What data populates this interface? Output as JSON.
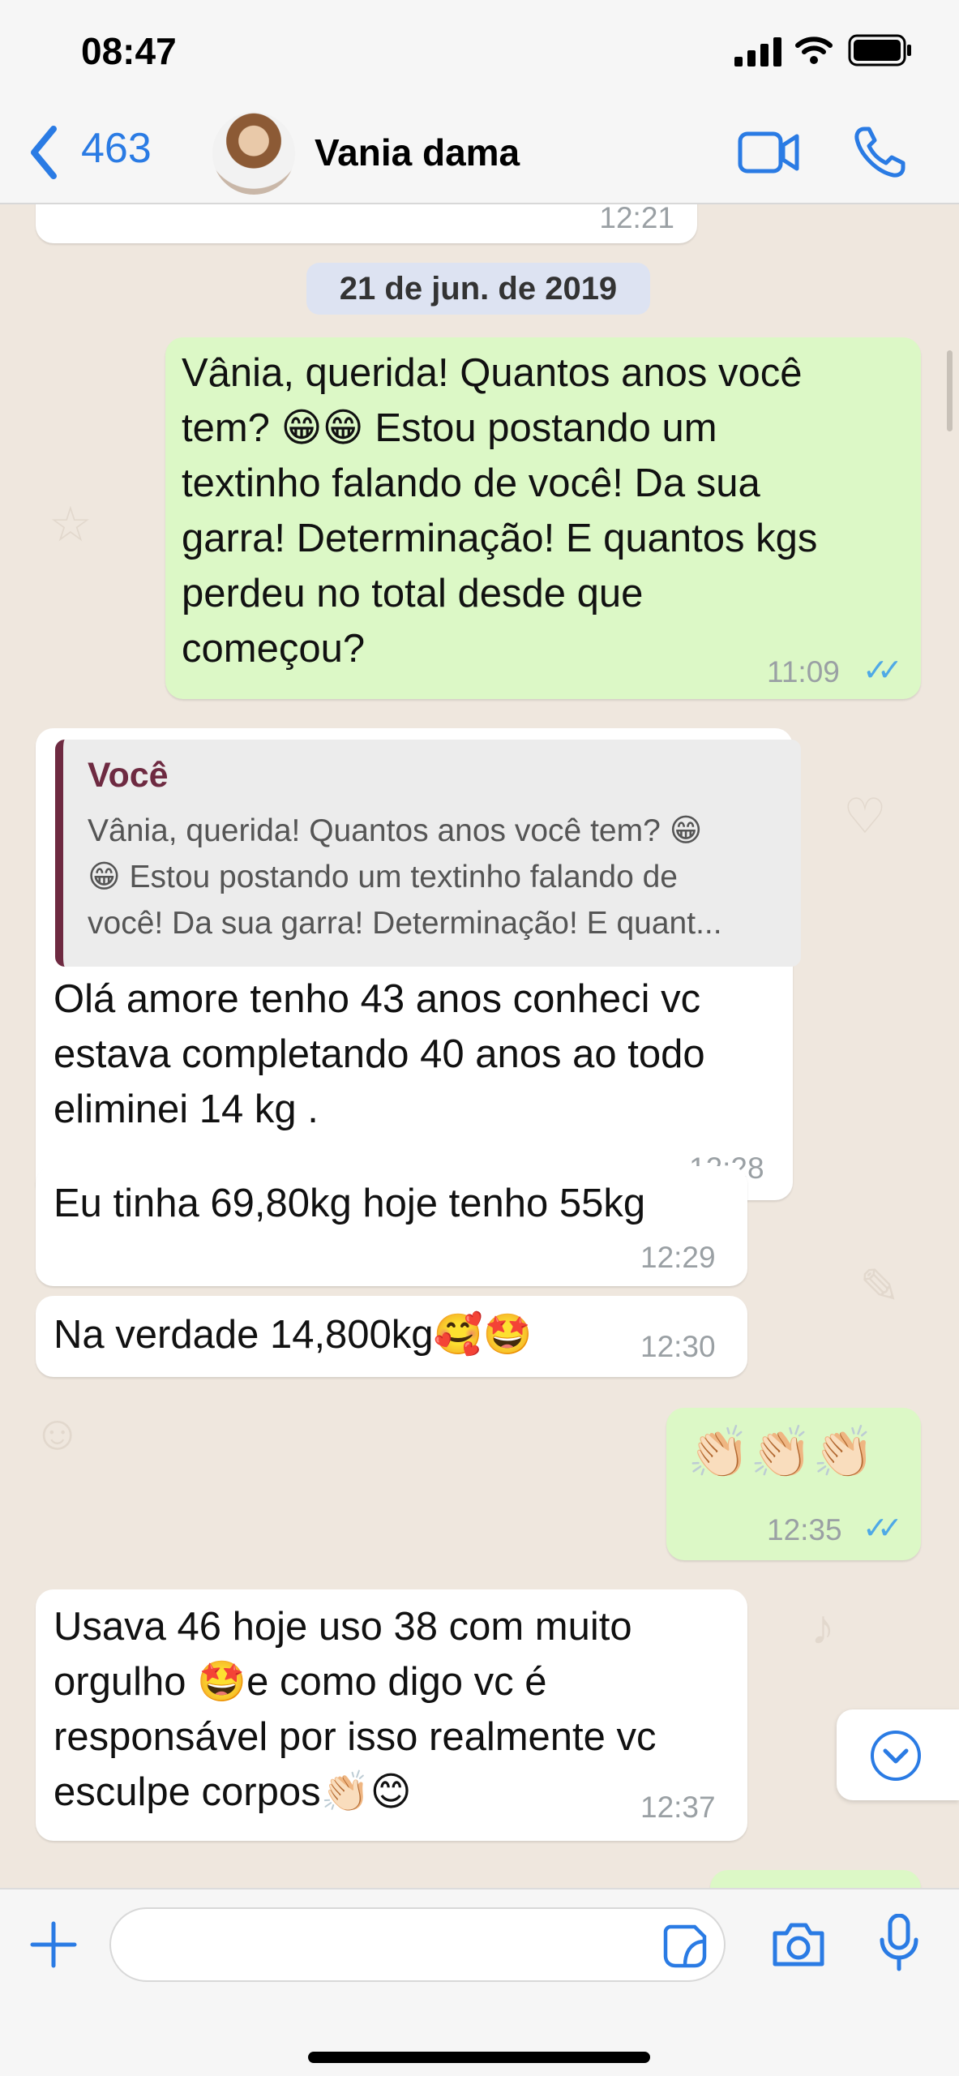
{
  "status_bar": {
    "time": "08:47"
  },
  "header": {
    "back_count": "463",
    "contact_name": "Vania dama"
  },
  "chat": {
    "top_partial_time": "12:21",
    "date_divider": "21 de jun. de 2019",
    "messages": [
      {
        "direction": "out",
        "text": "Vânia, querida! Quantos anos você\ntem? 😁😁 Estou postando um\ntextinho falando de você! Da sua\ngarra! Determinação! E quantos kgs\nperdeu no total desde que\ncomeçou?",
        "time": "11:09",
        "status": "read"
      },
      {
        "direction": "in",
        "quote": {
          "author": "Você",
          "text": "Vânia, querida! Quantos anos você tem? 😁\n😁 Estou postando um textinho falando de\nvocê! Da sua garra! Determinação! E quant..."
        },
        "text": "Olá amore tenho 43 anos conheci vc\nestava completando 40 anos ao todo\neliminei 14 kg .",
        "time": "12:28"
      },
      {
        "direction": "in",
        "text": "Eu tinha 69,80kg hoje tenho 55kg",
        "time": "12:29"
      },
      {
        "direction": "in",
        "text": "Na verdade 14,800kg🥰🤩",
        "time": "12:30"
      },
      {
        "direction": "out",
        "text": "👏🏻👏🏻👏🏻",
        "time": "12:35",
        "status": "read"
      },
      {
        "direction": "in",
        "text": "Usava 46 hoje uso 38 com muito\norgulho 🤩e como digo vc é\nresponsável por isso realmente vc\nesculpe corpos👏🏻😊",
        "time": "12:37"
      }
    ]
  },
  "input_bar": {
    "placeholder": ""
  },
  "icons": {
    "back": "chevron-left-icon",
    "video": "video-camera-icon",
    "call": "phone-icon",
    "add": "plus-icon",
    "sticker": "sticker-icon",
    "camera": "camera-icon",
    "mic": "microphone-icon",
    "scroll": "chevron-down-circle-icon",
    "read_receipt": "double-check-icon"
  },
  "colors": {
    "accent": "#2a7be4",
    "outgoing_bubble": "#dcf8c6",
    "incoming_bubble": "#ffffff",
    "chat_background": "#efe7de",
    "read_ticks": "#4fa9e6",
    "quote_author": "#6e2a41"
  }
}
